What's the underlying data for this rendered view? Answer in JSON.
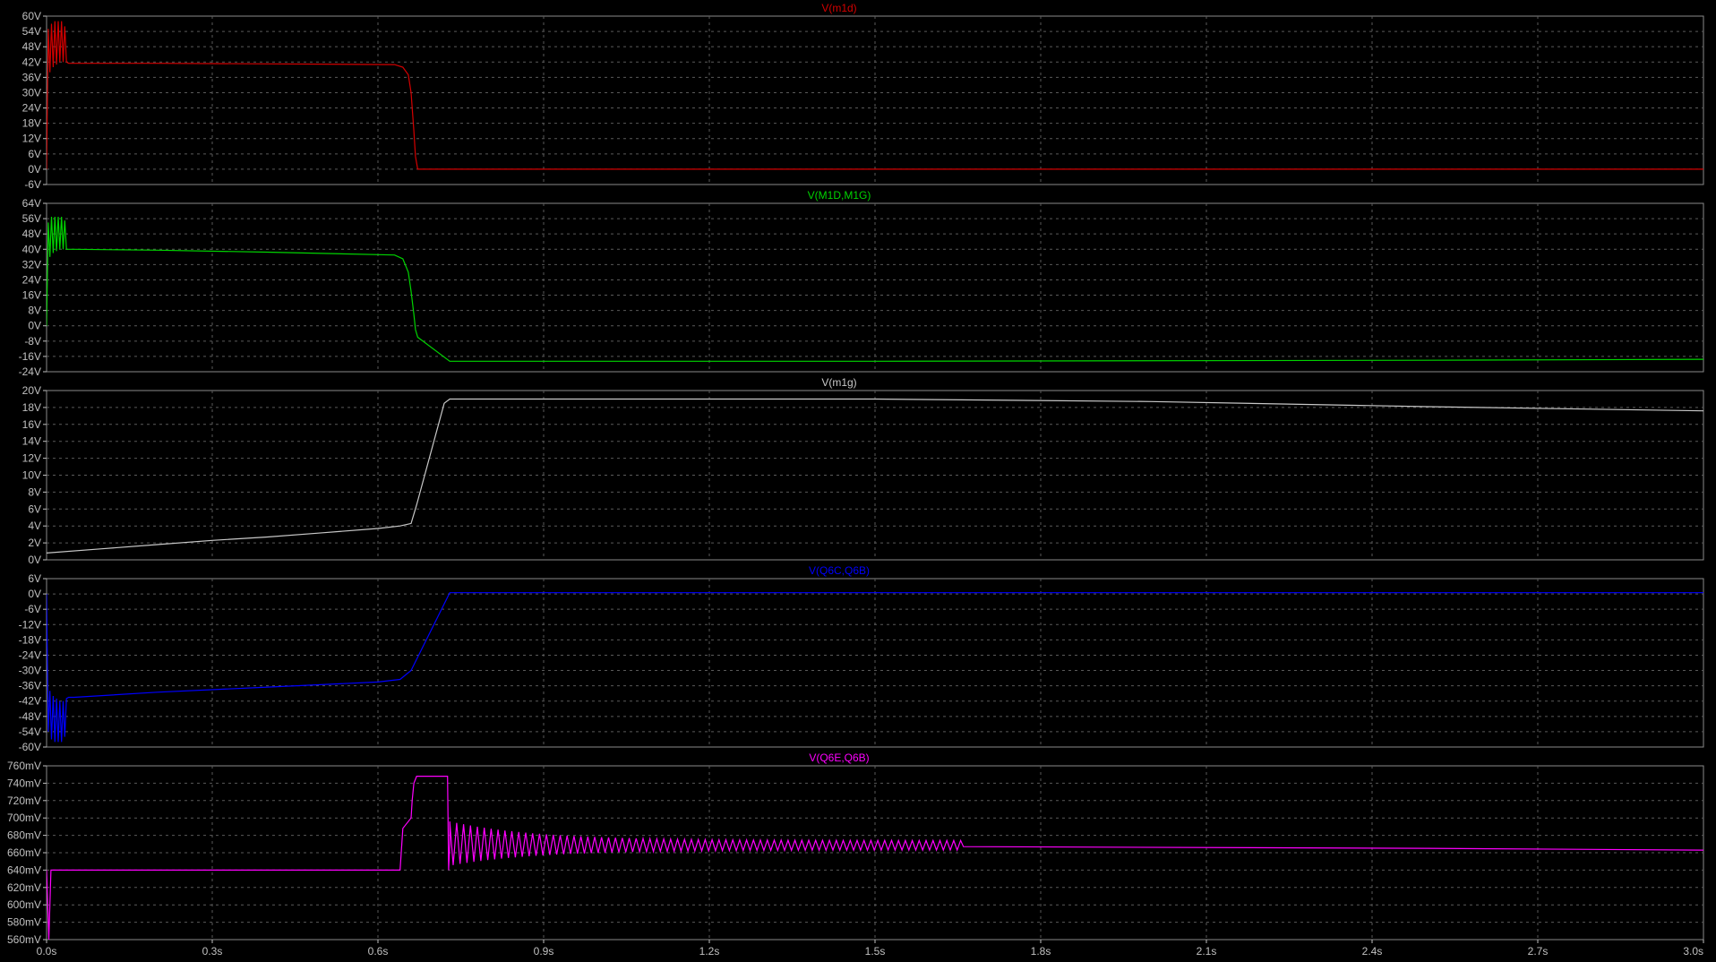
{
  "window_title": "",
  "chart_data": {
    "type": "line",
    "xlabel": "",
    "x_ticks": [
      "0.0s",
      "0.3s",
      "0.6s",
      "0.9s",
      "1.2s",
      "1.5s",
      "1.8s",
      "2.1s",
      "2.4s",
      "2.7s",
      "3.0s"
    ],
    "xlim": [
      0,
      3.0
    ],
    "x_unit": "s",
    "grid": true,
    "panes": [
      {
        "title": "V(m1d)",
        "color": "#d40000",
        "y_unit": "V",
        "ylim": [
          -6,
          60
        ],
        "y_ticks": [
          "60V",
          "54V",
          "48V",
          "42V",
          "36V",
          "30V",
          "24V",
          "18V",
          "12V",
          "6V",
          "0V",
          "-6V"
        ],
        "series": [
          {
            "name": "V(m1d)",
            "x": [
              0,
              0.003,
              0.006,
              0.009,
              0.012,
              0.015,
              0.018,
              0.021,
              0.024,
              0.027,
              0.03,
              0.033,
              0.036,
              0.04,
              0.05,
              0.2,
              0.4,
              0.63,
              0.645,
              0.655,
              0.66,
              0.665,
              0.668,
              0.672,
              3.0
            ],
            "y": [
              0,
              55,
              38,
              57,
              40,
              58,
              41,
              58,
              42,
              58,
              42,
              56,
              42,
              41.5,
              41.5,
              41.5,
              41.3,
              41,
              40,
              37,
              30,
              15,
              5,
              0,
              0
            ]
          }
        ]
      },
      {
        "title": "V(M1D,M1G)",
        "color": "#00d400",
        "y_unit": "V",
        "ylim": [
          -24,
          64
        ],
        "y_ticks": [
          "64V",
          "56V",
          "48V",
          "40V",
          "32V",
          "24V",
          "16V",
          "8V",
          "0V",
          "-8V",
          "-16V",
          "-24V"
        ],
        "series": [
          {
            "name": "V(M1D,M1G)",
            "x": [
              0,
              0.003,
              0.006,
              0.009,
              0.012,
              0.015,
              0.018,
              0.021,
              0.024,
              0.027,
              0.03,
              0.033,
              0.036,
              0.04,
              0.05,
              0.2,
              0.4,
              0.63,
              0.645,
              0.655,
              0.66,
              0.665,
              0.668,
              0.672,
              0.73,
              1.5,
              2.5,
              3.0
            ],
            "y": [
              0,
              54,
              36,
              57,
              38,
              57,
              39,
              57,
              40,
              57,
              40,
              55,
              40,
              40,
              40,
              39.5,
              38.5,
              37,
              35,
              28,
              18,
              6,
              -2,
              -6,
              -18.5,
              -18.5,
              -18,
              -17.5
            ]
          }
        ]
      },
      {
        "title": "V(m1g)",
        "color": "#c8c8c8",
        "y_unit": "V",
        "ylim": [
          0,
          20
        ],
        "y_ticks": [
          "20V",
          "18V",
          "16V",
          "14V",
          "12V",
          "10V",
          "8V",
          "6V",
          "4V",
          "2V",
          "0V"
        ],
        "series": [
          {
            "name": "V(m1g)",
            "x": [
              0,
              0.1,
              0.2,
              0.3,
              0.4,
              0.5,
              0.6,
              0.64,
              0.66,
              0.67,
              0.72,
              0.73,
              1.0,
              1.5,
              2.0,
              2.5,
              3.0
            ],
            "y": [
              0.8,
              1.3,
              1.8,
              2.3,
              2.7,
              3.2,
              3.7,
              4.0,
              4.3,
              6.5,
              18.5,
              19.0,
              19.0,
              19.0,
              18.7,
              18.1,
              17.6
            ]
          }
        ]
      },
      {
        "title": "V(Q6C,Q6B)",
        "color": "#0000ff",
        "y_unit": "V",
        "ylim": [
          -60,
          6
        ],
        "y_ticks": [
          "6V",
          "0V",
          "-6V",
          "-12V",
          "-18V",
          "-24V",
          "-30V",
          "-36V",
          "-42V",
          "-48V",
          "-54V",
          "-60V"
        ],
        "series": [
          {
            "name": "V(Q6C,Q6B)",
            "x": [
              0,
              0.003,
              0.006,
              0.009,
              0.012,
              0.015,
              0.018,
              0.021,
              0.024,
              0.027,
              0.03,
              0.033,
              0.036,
              0.04,
              0.05,
              0.2,
              0.4,
              0.6,
              0.64,
              0.66,
              0.73,
              1.0,
              2.0,
              3.0
            ],
            "y": [
              0,
              -54,
              -38,
              -57,
              -40,
              -58,
              -41,
              -58,
              -42,
              -58,
              -42,
              -56,
              -41,
              -40.5,
              -40.5,
              -38.5,
              -36.5,
              -34.5,
              -33.5,
              -30,
              0.5,
              0.5,
              0.5,
              0.5
            ]
          }
        ]
      },
      {
        "title": "V(Q6E,Q6B)",
        "color": "#ff00ff",
        "y_unit": "mV",
        "ylim": [
          560,
          760
        ],
        "y_ticks": [
          "760mV",
          "740mV",
          "720mV",
          "700mV",
          "680mV",
          "660mV",
          "640mV",
          "620mV",
          "600mV",
          "580mV",
          "560mV"
        ],
        "series": [
          {
            "name": "V(Q6E,Q6B)",
            "x": [
              0,
              0.004,
              0.008,
              0.6,
              0.64,
              0.645,
              0.66,
              0.662,
              0.665,
              0.67,
              0.726,
              0.728,
              0.73,
              0.74,
              1.65,
              1.66,
              2.5,
              3.0
            ],
            "y": [
              640,
              560,
              640,
              640,
              640,
              688,
              700,
              720,
              740,
              748,
              748,
              640,
              670,
              668,
              668,
              667,
              665,
              663
            ]
          }
        ],
        "ringing": {
          "x_start": 0.73,
          "x_end": 1.66,
          "center": 668,
          "amp_start": 40,
          "amp_end": 11,
          "period": 0.0125
        }
      }
    ]
  }
}
